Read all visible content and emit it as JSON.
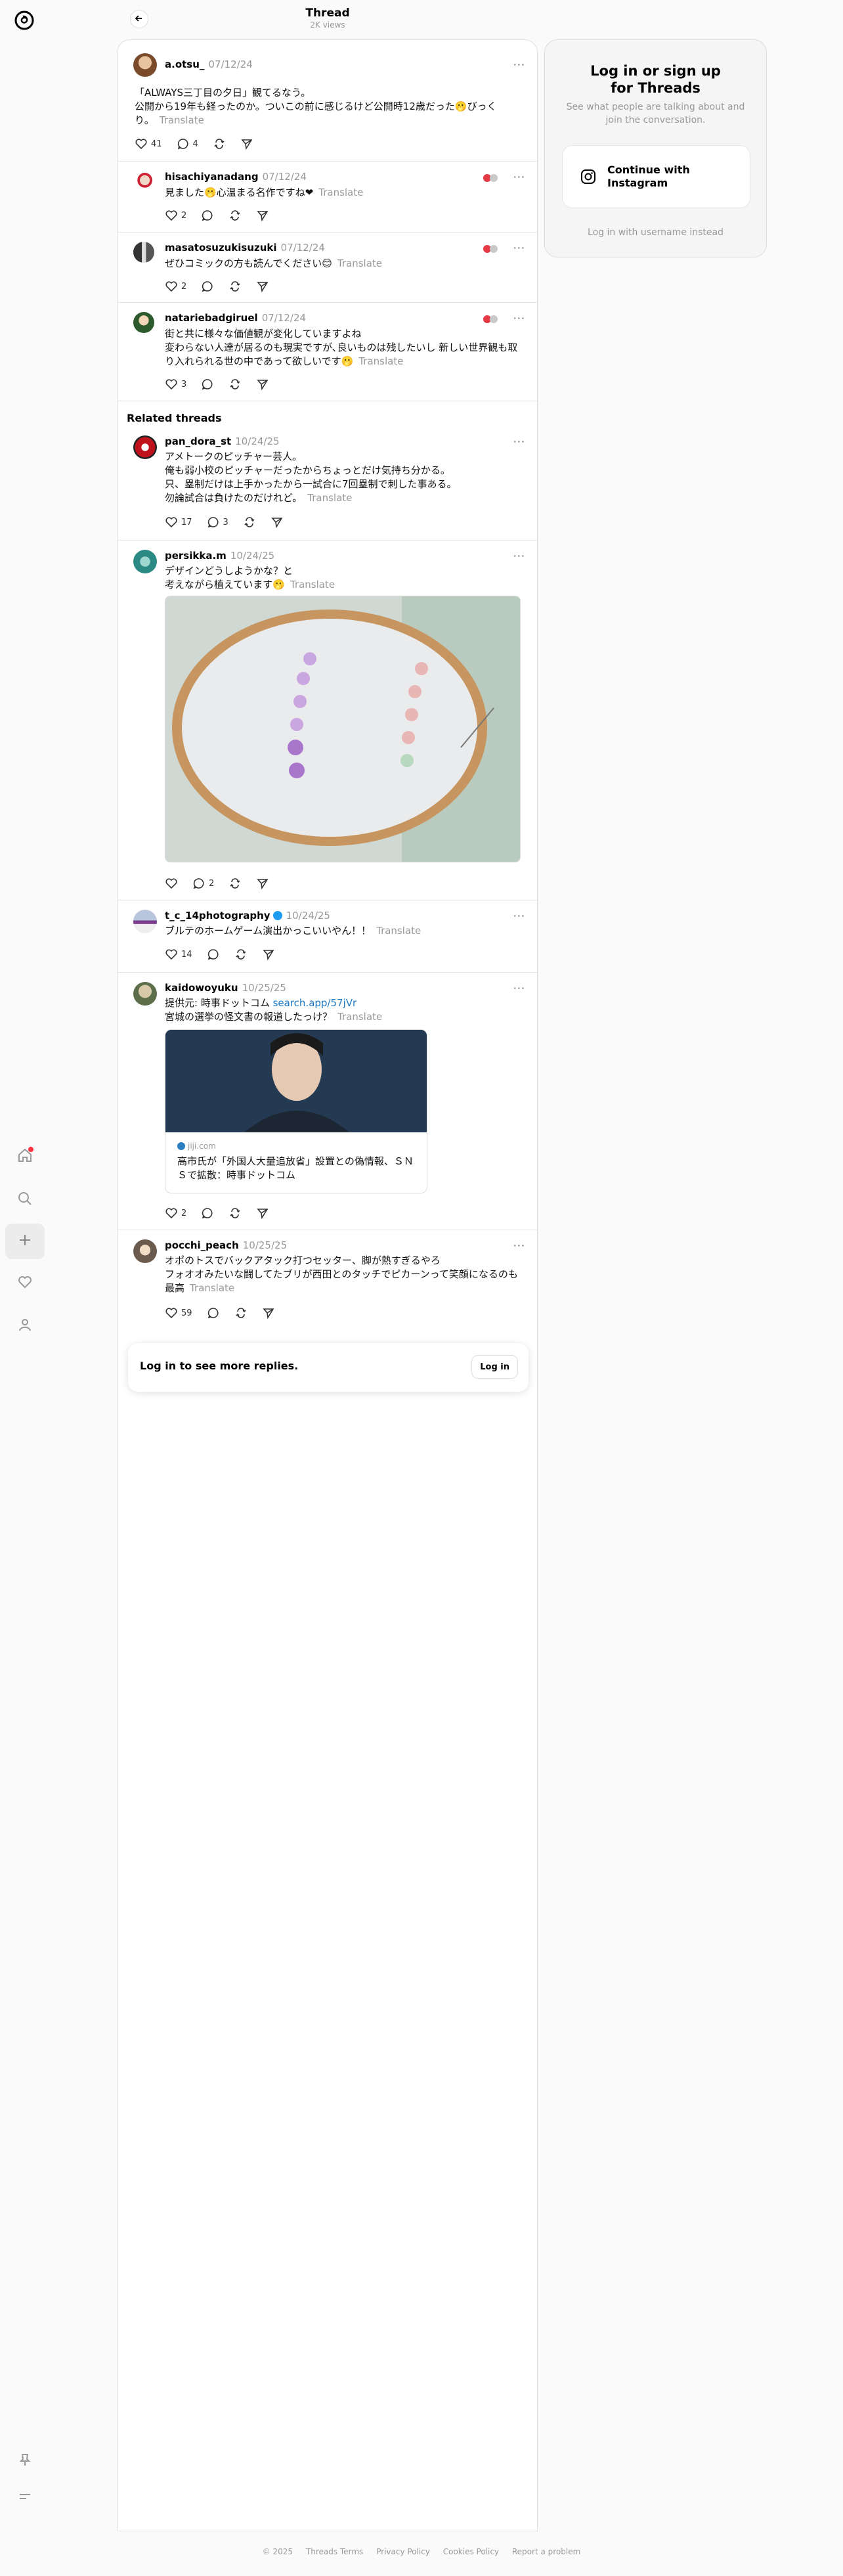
{
  "header": {
    "title": "Thread",
    "views": "2K views"
  },
  "nav": {
    "items": [
      "home-icon",
      "search-icon",
      "create-icon",
      "heart-icon",
      "profile-icon"
    ],
    "bottom": [
      "pin-icon",
      "menu-icon"
    ]
  },
  "sidebar": {
    "title_line1": "Log in or sign up",
    "title_line2": "for Threads",
    "subtitle": "See what people are talking about and join the conversation.",
    "ig_button_line1": "Continue with",
    "ig_button_line2": "Instagram",
    "alt_login": "Log in with username instead"
  },
  "translate_label": "Translate",
  "op": {
    "username": "a.otsu_",
    "date": "07/12/24",
    "line1": "「ALWAYS三丁目の夕日」観てるなう。",
    "line2": "公開から19年も経ったのか。ついこの前に感じるけど公開時12歳だった🫢びっく",
    "line3": "り。",
    "likes": "41",
    "replies": "4"
  },
  "replies": [
    {
      "username": "hisachiyanadang",
      "date": "07/12/24",
      "text": "見ました🫢心温まる名作ですね❤",
      "likes": "2"
    },
    {
      "username": "masatosuzukisuzuki",
      "date": "07/12/24",
      "text": "ぜひコミックの方も読んでください😊",
      "likes": "2"
    },
    {
      "username": "natariebadgiruel",
      "date": "07/12/24",
      "line1": "街と共に様々な価値観が変化していますよね",
      "line2": "変わらない人達が居るのも現実ですが､良いものは残したいし 新しい世界観も取",
      "line3": "り入れられる世の中であって欲しいです🫢",
      "likes": "3"
    }
  ],
  "related_title": "Related threads",
  "related": [
    {
      "username": "pan_dora_st",
      "date": "10/24/25",
      "line1": "アメトークのピッチャー芸人。",
      "line2": "俺も弱小校のピッチャーだったからちょっとだけ気持ち分かる。",
      "line3": "只、塁制だけは上手かったから一試合に7回塁制で刺した事ある。",
      "line4": "勿論試合は負けたのだけれど。",
      "likes": "17",
      "replies": "3"
    },
    {
      "username": "persikka.m",
      "date": "10/24/25",
      "line1": "デザインどうしようかな？と",
      "line2": "考えながら植えています🫢",
      "replies": "2"
    },
    {
      "username": "t_c_14photography",
      "date": "10/24/25",
      "text": "ブルテのホームゲーム演出かっこいいやん！！",
      "likes": "14"
    },
    {
      "username": "kaidowoyuku",
      "date": "10/25/25",
      "line1_prefix": "提供元: 時事ドットコム ",
      "line1_link": "search.app/57jVr",
      "line2": "宮城の選挙の怪文書の報道したっけ？",
      "card_source": "jiji.com",
      "card_title1": "高市氏が「外国人大量追放省」設置との偽情報、ＳＮ",
      "card_title2": "Ｓで拡散：時事ドットコム",
      "likes": "2"
    },
    {
      "username": "pocchi_peach",
      "date": "10/25/25",
      "line1": "オポのトスでバックアタック打つセッター、脚が熱すぎるやろ",
      "line2": "フォオオみたいな闘してたブリが西田とのタッチでピカーンって笑顔になるのも",
      "line3": "最高",
      "likes": "59"
    }
  ],
  "login_bar": {
    "text": "Log in to see more replies.",
    "button": "Log in"
  },
  "footer": [
    "© 2025",
    "Threads Terms",
    "Privacy Policy",
    "Cookies Policy",
    "Report a problem"
  ],
  "colors": {
    "accent_link": "#1d79c4",
    "notification": "#ff3040",
    "verified": "#1d9bf0"
  }
}
